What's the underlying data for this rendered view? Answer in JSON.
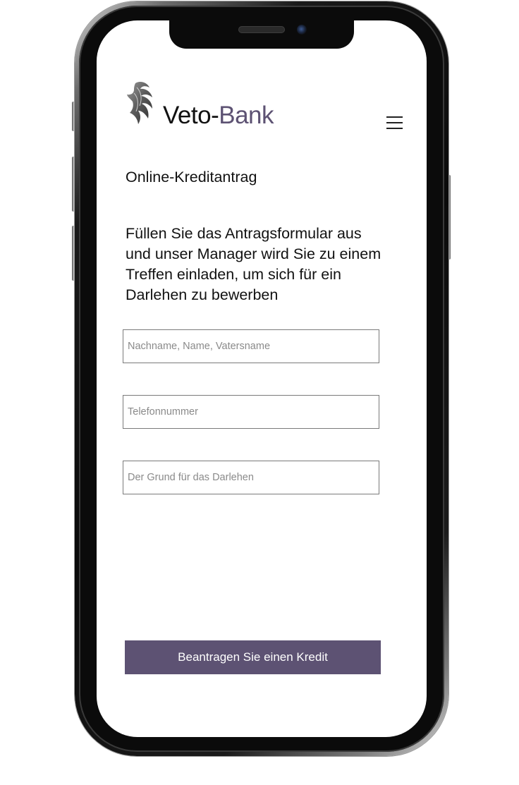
{
  "header": {
    "brand_prefix": "Veto-",
    "brand_suffix": "Bank",
    "logo_icon": "phoenix-wing-icon",
    "menu_icon": "hamburger-menu-icon"
  },
  "page": {
    "title": "Online-Kreditantrag",
    "intro": "Füllen Sie das Antragsformular aus und unser Manager wird Sie zu einem Treffen einladen, um sich für ein Darlehen zu bewerben"
  },
  "form": {
    "name_placeholder": "Nachname, Name, Vatersname",
    "phone_placeholder": "Telefonnummer",
    "reason_placeholder": "Der Grund für das Darlehen",
    "submit_label": "Beantragen Sie einen Kredit"
  },
  "colors": {
    "accent": "#5d5273",
    "text": "#111111",
    "placeholder": "#8a8a8a",
    "border": "#7a7a7a"
  }
}
